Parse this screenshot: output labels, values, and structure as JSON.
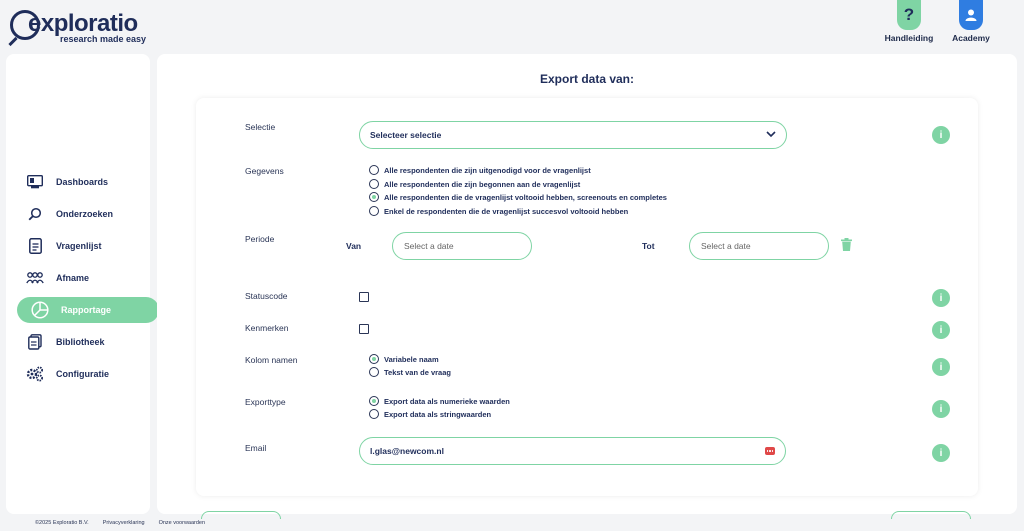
{
  "brand": {
    "name": "exploratio",
    "tagline": "research made easy"
  },
  "header": {
    "help_label": "Handleiding",
    "help_glyph": "?",
    "academy_label": "Academy"
  },
  "sidebar": {
    "items": [
      {
        "label": "Dashboards",
        "icon": "dashboard-icon",
        "active": false
      },
      {
        "label": "Onderzoeken",
        "icon": "search-icon",
        "active": false
      },
      {
        "label": "Vragenlijst",
        "icon": "document-icon",
        "active": false
      },
      {
        "label": "Afname",
        "icon": "group-icon",
        "active": false
      },
      {
        "label": "Rapportage",
        "icon": "pie-chart-icon",
        "active": true
      },
      {
        "label": "Bibliotheek",
        "icon": "library-icon",
        "active": false
      },
      {
        "label": "Configuratie",
        "icon": "gears-icon",
        "active": false
      }
    ]
  },
  "main": {
    "title": "Export data van:",
    "selectie": {
      "label": "Selectie",
      "value": "Selecteer selectie"
    },
    "gegevens": {
      "label": "Gegevens",
      "options": [
        {
          "label": "Alle respondenten die zijn uitgenodigd voor de vragenlijst",
          "selected": false
        },
        {
          "label": "Alle respondenten die zijn begonnen aan de vragenlijst",
          "selected": false
        },
        {
          "label": "Alle respondenten die de vragenlijst voltooid hebben, screenouts en completes",
          "selected": true
        },
        {
          "label": "Enkel de respondenten die de vragenlijst succesvol voltooid hebben",
          "selected": false
        }
      ]
    },
    "periode": {
      "label": "Periode",
      "from_label": "Van",
      "to_label": "Tot",
      "from_placeholder": "Select a date",
      "to_placeholder": "Select a date"
    },
    "statuscode": {
      "label": "Statuscode",
      "checked": false
    },
    "kenmerken": {
      "label": "Kenmerken",
      "checked": false
    },
    "kolom_namen": {
      "label": "Kolom namen",
      "options": [
        {
          "label": "Variabele naam",
          "selected": true
        },
        {
          "label": "Tekst van de vraag",
          "selected": false
        }
      ]
    },
    "exporttype": {
      "label": "Exporttype",
      "options": [
        {
          "label": "Export data als numerieke waarden",
          "selected": true
        },
        {
          "label": "Export data als stringwaarden",
          "selected": false
        }
      ]
    },
    "email": {
      "label": "Email",
      "value": "l.glas@newcom.nl"
    },
    "info_glyph": "i"
  },
  "footer": {
    "copyright": "©2025 Exploratio B.V.",
    "privacy": "Privacyverklaring",
    "terms": "Onze voorwaarden"
  },
  "colors": {
    "accent": "#7fd4a4",
    "navy": "#1f2d5a",
    "academy": "#2f7de1",
    "badge": "#e04848"
  }
}
